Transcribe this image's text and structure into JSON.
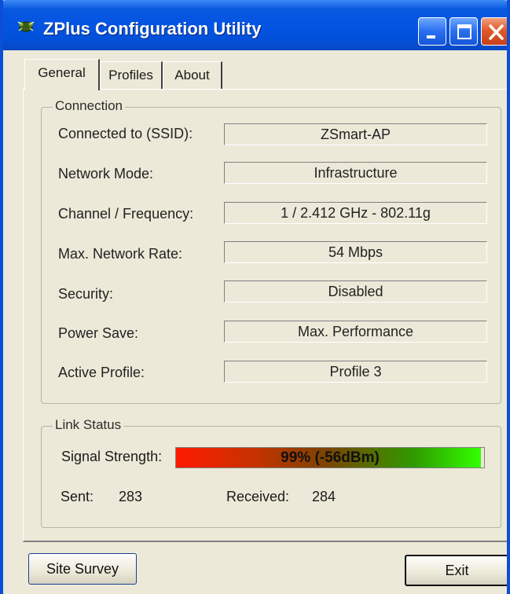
{
  "window": {
    "title": "ZPlus Configuration Utility",
    "app_icon": "bug-icon",
    "controls": [
      "minimize-icon",
      "maximize-icon",
      "close-icon"
    ]
  },
  "tabs": [
    {
      "label": "General",
      "active": true
    },
    {
      "label": "Profiles",
      "active": false
    },
    {
      "label": "About",
      "active": false
    }
  ],
  "connection": {
    "legend": "Connection",
    "fields": [
      {
        "label": "Connected to (SSID):",
        "value": "ZSmart-AP"
      },
      {
        "label": "Network Mode:",
        "value": "Infrastructure"
      },
      {
        "label": "Channel / Frequency:",
        "value": "1 / 2.412 GHz - 802.11g"
      },
      {
        "label": "Max. Network Rate:",
        "value": "54 Mbps"
      },
      {
        "label": "Security:",
        "value": "Disabled"
      },
      {
        "label": "Power Save:",
        "value": "Max. Performance"
      },
      {
        "label": "Active Profile:",
        "value": "Profile 3"
      }
    ]
  },
  "link_status": {
    "legend": "Link Status",
    "signal_label": "Signal Strength:",
    "signal_text": "99% (-56dBm)",
    "signal_fraction": 0.99,
    "sent_label": "Sent:",
    "sent_value": "283",
    "received_label": "Received:",
    "received_value": "284"
  },
  "buttons": {
    "site_survey": "Site Survey",
    "exit": "Exit"
  },
  "colors": {
    "title_bar": "#0354e3",
    "window_bg": "#ece9d8",
    "signal_low": "#ff1a00",
    "signal_high": "#33ff00"
  }
}
